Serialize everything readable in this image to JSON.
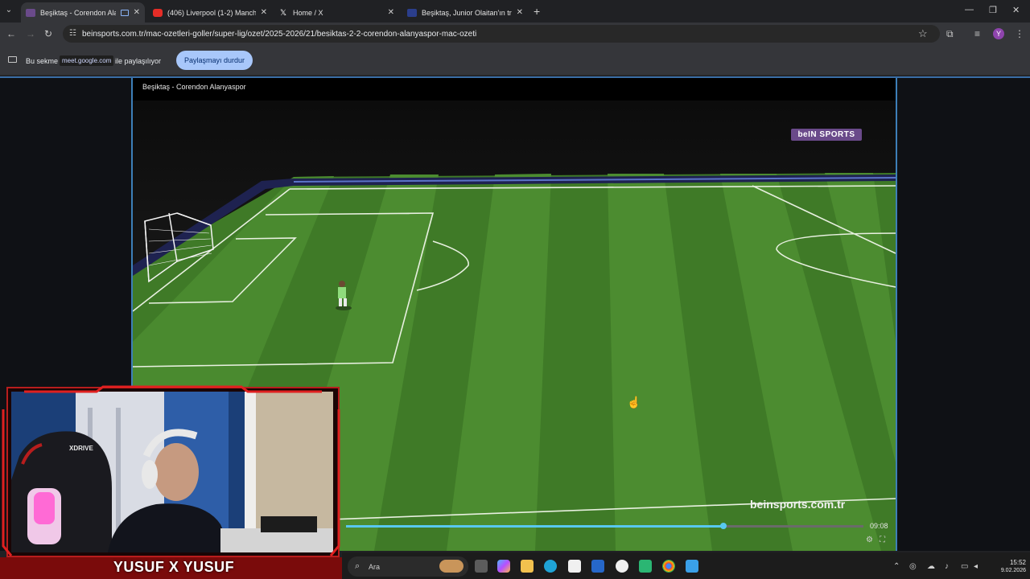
{
  "browser": {
    "tabs": [
      {
        "title": "Beşiktaş - Corendon Alanya",
        "active": true,
        "favicon": "bein-favicon"
      },
      {
        "title": "(406) Liverpool (1-2) Manchest",
        "active": false,
        "favicon": "youtube-favicon"
      },
      {
        "title": "Home / X",
        "active": false,
        "favicon": "x-favicon"
      },
      {
        "title": "Beşiktaş, Junior Olaitan'ın transf",
        "active": false,
        "favicon": "news-favicon"
      }
    ],
    "url": "beinsports.com.tr/mac-ozetleri-goller/super-lig/ozet/2025-2026/21/besiktas-2-2-corendon-alanyaspor-mac-ozeti",
    "profile_initial": "Y"
  },
  "sharebar": {
    "text_before": "Bu sekme",
    "host": "meet.google.com",
    "text_after": "ile paylaşılıyor",
    "stop_button": "Paylaşmayı durdur"
  },
  "video": {
    "title": "Beşiktaş - Corendon Alanyaspor",
    "logo_text": "beIN SPORTS",
    "watermark": "beinsports.com.tr",
    "timecode": "09:08",
    "progress": 0.73
  },
  "webcam": {
    "name": "YUSUF X YUSUF",
    "chair_brand": "XDRIVE"
  },
  "taskbar": {
    "search_placeholder": "Ara",
    "time": "15:52",
    "date": "9.02.2026"
  },
  "colors": {
    "accent": "#a8c7fa",
    "pitch_light": "#4f8f2e",
    "pitch_dark": "#3c7424",
    "cam_red": "#b81d1d",
    "progress": "#58c8f0"
  }
}
